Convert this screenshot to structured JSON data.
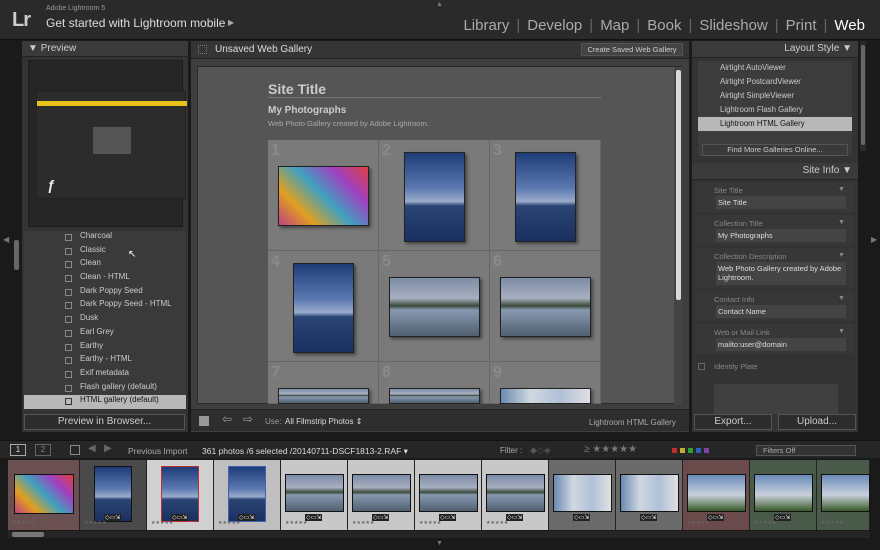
{
  "app": {
    "name": "Adobe Lightroom 5",
    "logo": "Lr",
    "identity_text": "Get started with Lightroom mobile"
  },
  "modules": [
    "Library",
    "Develop",
    "Map",
    "Book",
    "Slideshow",
    "Print",
    "Web"
  ],
  "active_module": "Web",
  "left_panel": {
    "preview_title": "Preview",
    "preview_icon": "flash-icon",
    "templates": [
      "Charcoal",
      "Classic",
      "Clean",
      "Clean - HTML",
      "Dark Poppy Seed",
      "Dark Poppy Seed - HTML",
      "Dusk",
      "Earl Grey",
      "Earthy",
      "Earthy - HTML",
      "Exif metadata",
      "Flash gallery (default)",
      "HTML gallery (default)"
    ],
    "selected_template": "HTML gallery (default)",
    "preview_button": "Preview in Browser..."
  },
  "center": {
    "gallery_name": "Unsaved Web Gallery",
    "save_button": "Create Saved Web Gallery",
    "site_title": "Site Title",
    "collection_title": "My Photographs",
    "collection_desc": "Web Photo Gallery created by Adobe Lightroom.",
    "cell_numbers": [
      "1",
      "2",
      "3",
      "4",
      "5",
      "6",
      "7",
      "8",
      "9"
    ],
    "use_label": "Use:",
    "use_value": "All Filmstrip Photos",
    "engine_label": "Lightroom HTML Gallery"
  },
  "right_panel": {
    "layout_style_title": "Layout Style",
    "layout_styles": [
      "Airtight AutoViewer",
      "Airtight PostcardViewer",
      "Airtight SimpleViewer",
      "Lightroom Flash Gallery",
      "Lightroom HTML Gallery"
    ],
    "selected_style": "Lightroom HTML Gallery",
    "find_more": "Find More Galleries Online...",
    "site_info_title": "Site Info",
    "fields": [
      {
        "label": "Site Title",
        "value": "Site Title"
      },
      {
        "label": "Collection Title",
        "value": "My Photographs"
      },
      {
        "label": "Collection Description",
        "value": "Web Photo Gallery created by Adobe Lightroom."
      },
      {
        "label": "Contact Info",
        "value": "Contact Name"
      },
      {
        "label": "Web or Mail Link",
        "value": "mailto:user@domain"
      }
    ],
    "identity_plate": "Identity Plate",
    "export_button": "Export...",
    "upload_button": "Upload..."
  },
  "filmstrip": {
    "view1": "1",
    "view2": "2",
    "previous_import": "Previous Import",
    "photo_count": "361 photos",
    "selection_info": "/6 selected /20140711-DSCF1813-2.RAF",
    "filter_label": "Filter :",
    "filter_value": "Filters Off",
    "rating_icon": "≥ ★★★★★",
    "color_labels": [
      "#c03030",
      "#c0b030",
      "#30a030",
      "#3060c0",
      "#8040a0"
    ]
  }
}
